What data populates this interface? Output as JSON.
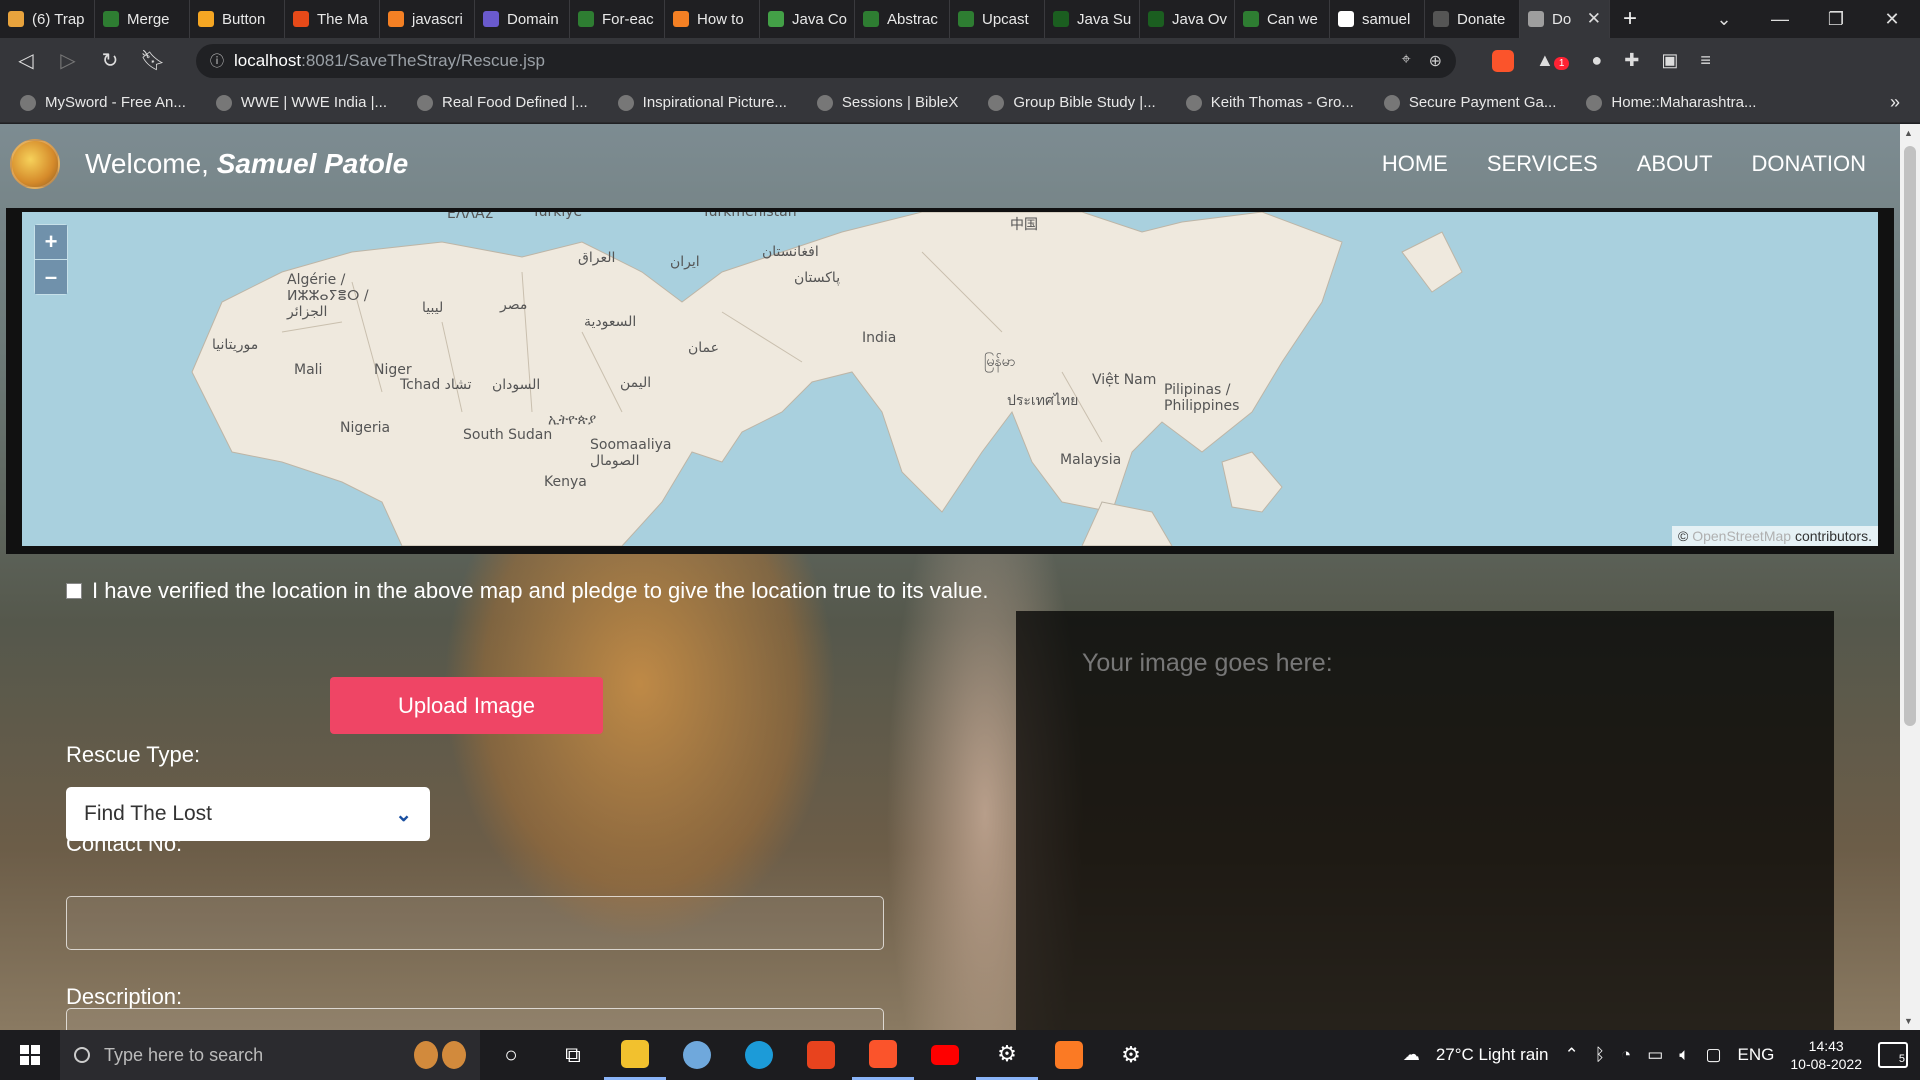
{
  "browser": {
    "tabs": [
      {
        "label": "(6) Trap",
        "color": "#e8a33d"
      },
      {
        "label": "Merge",
        "color": "#2e7d32"
      },
      {
        "label": "Button",
        "color": "#f5a623"
      },
      {
        "label": "The Ma",
        "color": "#e64a19"
      },
      {
        "label": "javascri",
        "color": "#f48024"
      },
      {
        "label": "Domain",
        "color": "#6a5acd"
      },
      {
        "label": "For-eac",
        "color": "#2e7d32"
      },
      {
        "label": "How to",
        "color": "#f48024"
      },
      {
        "label": "Java Co",
        "color": "#43a047"
      },
      {
        "label": "Abstrac",
        "color": "#2e7d32"
      },
      {
        "label": "Upcast",
        "color": "#2e7d32"
      },
      {
        "label": "Java Su",
        "color": "#1b5e20"
      },
      {
        "label": "Java Ov",
        "color": "#1b5e20"
      },
      {
        "label": "Can we",
        "color": "#2e7d32"
      },
      {
        "label": "samuel",
        "color": "#ffffff"
      },
      {
        "label": "Donate",
        "color": "#555555"
      },
      {
        "label": "Do",
        "color": "#9e9e9e"
      }
    ],
    "new_tab": "+",
    "url_host": "localhost",
    "url_path": ":8081/SaveTheStray/Rescue.jsp",
    "bookmarks": [
      "MySword - Free An...",
      "WWE | WWE India |...",
      "Real Food Defined |...",
      "Inspirational Picture...",
      "Sessions | BibleX",
      "Group Bible Study |...",
      "Keith Thomas - Gro...",
      "Secure Payment Ga...",
      "Home::Maharashtra..."
    ],
    "notification_badge": "1"
  },
  "page": {
    "welcome_prefix": "Welcome, ",
    "username": "Samuel Patole",
    "nav": [
      "HOME",
      "SERVICES",
      "ABOUT",
      "DONATION"
    ],
    "map": {
      "zoom_in": "+",
      "zoom_out": "–",
      "attribution_symbol": "©",
      "attribution_link": "OpenStreetMap",
      "attribution_text": "contributors.",
      "labels": {
        "algerie": "Algérie / ⵍⵣⵣⴰⵢⴻⵔ / الجزائر",
        "mauritania": "موريتانيا",
        "mali": "Mali",
        "niger": "Niger",
        "tchad": "Tchad تشاد",
        "nigeria": "Nigeria",
        "libya": "ليبيا",
        "egypt": "مصر",
        "sudan": "السودان",
        "south_sudan": "South Sudan",
        "ethiopia": "ኢትዮጵያ",
        "somalia": "Soomaaliya الصومال",
        "kenya": "Kenya",
        "iraq": "العراق",
        "iran": "ایران",
        "saudi": "السعودية",
        "oman": "عمان",
        "yemen": "اليمن",
        "afghanistan": "افغانستان",
        "pakistan": "پاکستان",
        "india": "India",
        "myanmar": "မြန်မာ",
        "thailand": "ประเทศไทย",
        "vietnam": "Việt Nam",
        "philippines": "Pilipinas / Philippines",
        "malaysia": "Malaysia",
        "china": "中国",
        "turkmenistan": "Türkmenistan",
        "turkiye": "Türkiye",
        "misr_top": "ΕΛΛΑΣ"
      }
    },
    "pledge_text": "I have verified the location in the above map and pledge to give the location true to its value.",
    "upload_button": "Upload Image",
    "image_placeholder": "Your image goes here:",
    "rescue_type_label": "Rescue Type:",
    "rescue_type_value": "Find The Lost",
    "contact_label": "Contact No:",
    "description_label": "Description:"
  },
  "taskbar": {
    "search_placeholder": "Type here to search",
    "weather": "27°C  Light rain",
    "language": "ENG",
    "time": "14:43",
    "date": "10-08-2022",
    "notifications": "5"
  }
}
